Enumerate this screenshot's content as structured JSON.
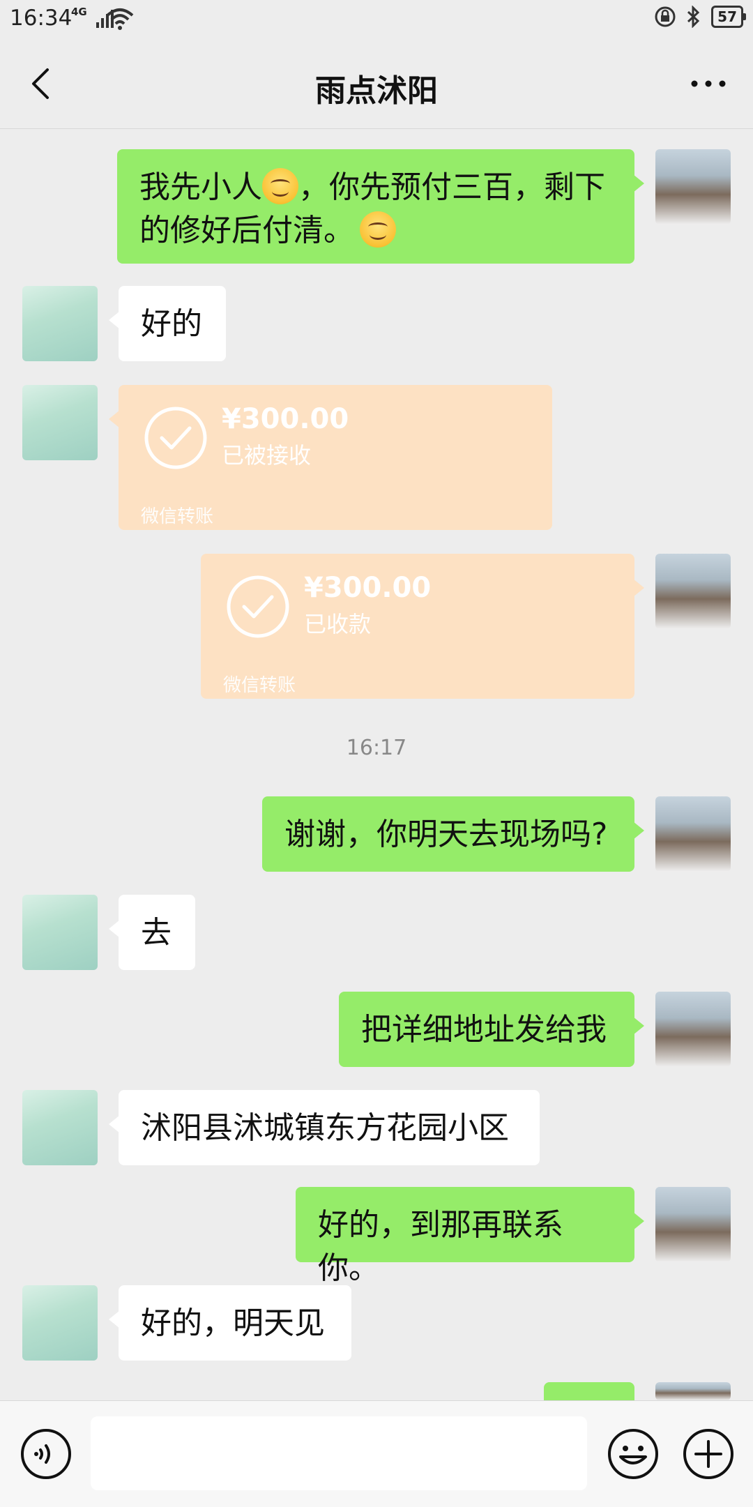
{
  "status_bar": {
    "time": "16:34",
    "network": "4G",
    "battery": "57"
  },
  "header": {
    "title": "雨点沭阳"
  },
  "messages": [
    {
      "from": "me",
      "line1": "我先小人",
      "line1_after": "，你先预付三百，剩下",
      "line2": "的修好后付清。"
    },
    {
      "from": "her",
      "text": "好的"
    },
    {
      "from": "her",
      "type": "transfer",
      "amount": "¥300.00",
      "status": "已被接收",
      "footer": "微信转账"
    },
    {
      "from": "me",
      "type": "transfer",
      "amount": "¥300.00",
      "status": "已收款",
      "footer": "微信转账"
    },
    {
      "from": "me",
      "text": "谢谢，你明天去现场吗?"
    },
    {
      "from": "her",
      "text": "去"
    },
    {
      "from": "me",
      "text": "把详细地址发给我"
    },
    {
      "from": "her",
      "text": "沭阳县沭城镇东方花园小区"
    },
    {
      "from": "me",
      "text": "好的，到那再联系你。"
    },
    {
      "from": "her",
      "text": "好的，明天见"
    }
  ],
  "timestamp": "16:17",
  "colors": {
    "my_bubble": "#95ec69",
    "her_bubble": "#ffffff",
    "transfer_card": "#fde1c3",
    "background": "#ededed"
  }
}
